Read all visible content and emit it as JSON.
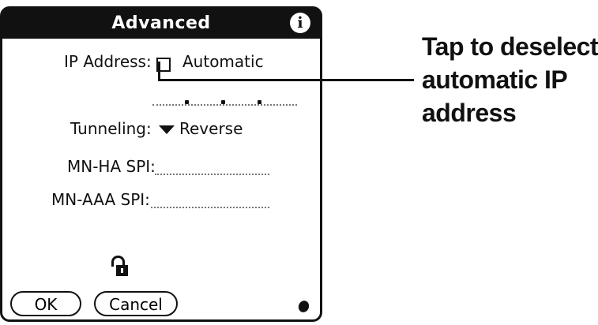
{
  "dialog": {
    "title": "Advanced",
    "info_icon_glyph": "i",
    "ip_address_label": "IP Address:",
    "automatic_label": "Automatic",
    "automatic_checked": false,
    "tunneling_label": "Tunneling:",
    "tunneling_value": "Reverse",
    "mn_ha_spi_label": "MN-HA SPI:",
    "mn_ha_spi_value": "",
    "mn_aaa_spi_label": "MN-AAA SPI:",
    "mn_aaa_spi_value": "",
    "ok_label": "OK",
    "cancel_label": "Cancel"
  },
  "callout": {
    "lines": [
      "Tap to deselect",
      "automatic IP",
      "address"
    ]
  },
  "icons": [
    "info-icon",
    "dropdown-triangle-icon",
    "unlocked-padlock-icon",
    "corner-dot-icon"
  ]
}
